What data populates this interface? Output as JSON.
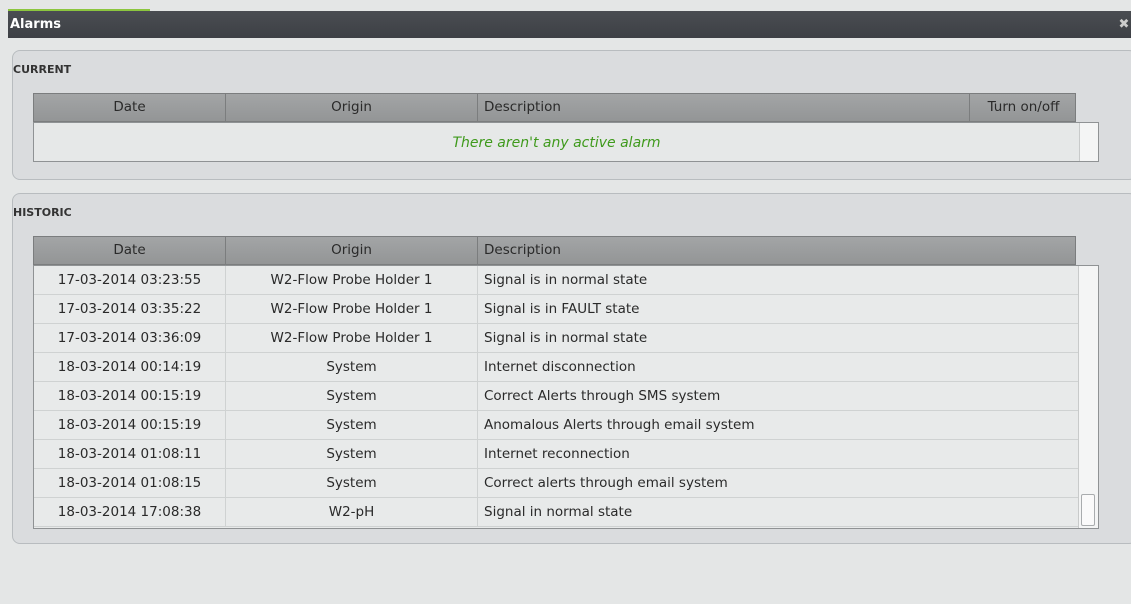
{
  "window": {
    "title": "Alarms",
    "close_glyph": "✖"
  },
  "current": {
    "legend": "CURRENT",
    "columns": [
      "Date",
      "Origin",
      "Description",
      "Turn on/off"
    ],
    "empty_message": "There aren't any active alarm"
  },
  "historic": {
    "legend": "HISTORIC",
    "columns": [
      "Date",
      "Origin",
      "Description"
    ],
    "rows": [
      {
        "date": "17-03-2014 03:23:55",
        "origin": "W2-Flow Probe Holder 1",
        "description": "Signal is in normal state"
      },
      {
        "date": "17-03-2014 03:35:22",
        "origin": "W2-Flow Probe Holder 1",
        "description": "Signal is in FAULT state"
      },
      {
        "date": "17-03-2014 03:36:09",
        "origin": "W2-Flow Probe Holder 1",
        "description": "Signal is in normal state"
      },
      {
        "date": "18-03-2014 00:14:19",
        "origin": "System",
        "description": "Internet disconnection"
      },
      {
        "date": "18-03-2014 00:15:19",
        "origin": "System",
        "description": "Correct Alerts through SMS system"
      },
      {
        "date": "18-03-2014 00:15:19",
        "origin": "System",
        "description": "Anomalous Alerts through email system"
      },
      {
        "date": "18-03-2014 01:08:11",
        "origin": "System",
        "description": "Internet reconnection"
      },
      {
        "date": "18-03-2014 01:08:15",
        "origin": "System",
        "description": "Correct alerts through email system"
      },
      {
        "date": "18-03-2014 17:08:38",
        "origin": "W2-pH",
        "description": "Signal in normal state"
      }
    ]
  },
  "colors": {
    "accent": "#8cc63f",
    "empty_message": "#3f9a1c",
    "titlebar": "#3d4045"
  }
}
